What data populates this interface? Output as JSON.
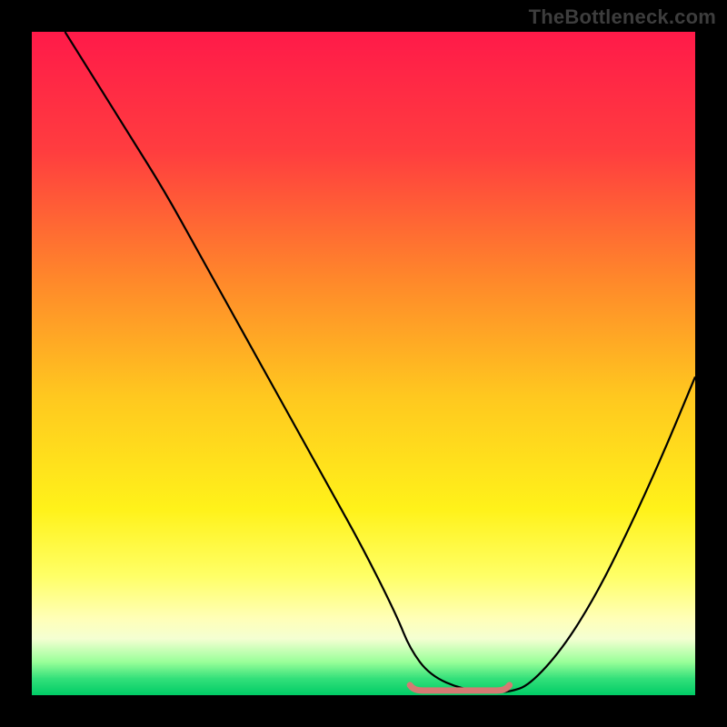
{
  "watermark": "TheBottleneck.com",
  "colors": {
    "frame": "#000000",
    "curve": "#000000",
    "flat_marker": "#d57a73",
    "gradient_stops": [
      {
        "offset": 0.0,
        "color": "#ff1a49"
      },
      {
        "offset": 0.18,
        "color": "#ff3d3f"
      },
      {
        "offset": 0.38,
        "color": "#ff8a2a"
      },
      {
        "offset": 0.55,
        "color": "#ffc81f"
      },
      {
        "offset": 0.72,
        "color": "#fff21a"
      },
      {
        "offset": 0.82,
        "color": "#ffff66"
      },
      {
        "offset": 0.885,
        "color": "#ffffb8"
      },
      {
        "offset": 0.915,
        "color": "#f4ffd2"
      },
      {
        "offset": 0.95,
        "color": "#99ff99"
      },
      {
        "offset": 0.975,
        "color": "#33e07a"
      },
      {
        "offset": 1.0,
        "color": "#00cc66"
      }
    ]
  },
  "chart_data": {
    "type": "line",
    "title": "",
    "xlabel": "",
    "ylabel": "",
    "xlim": [
      0,
      100
    ],
    "ylim": [
      0,
      100
    ],
    "legend": false,
    "grid": false,
    "series": [
      {
        "name": "bottleneck-curve",
        "x": [
          5,
          10,
          15,
          20,
          25,
          30,
          35,
          40,
          45,
          50,
          55,
          57,
          60,
          65,
          70,
          72,
          75,
          80,
          85,
          90,
          95,
          100
        ],
        "values": [
          100,
          92,
          84,
          76,
          67,
          58,
          49,
          40,
          31,
          22,
          12,
          7,
          3,
          0.8,
          0.5,
          0.5,
          1.5,
          7,
          15,
          25,
          36,
          48
        ]
      }
    ],
    "annotations": [
      {
        "name": "flat-minimum-marker",
        "x_start": 57,
        "x_end": 72,
        "y": 0.7
      }
    ]
  }
}
